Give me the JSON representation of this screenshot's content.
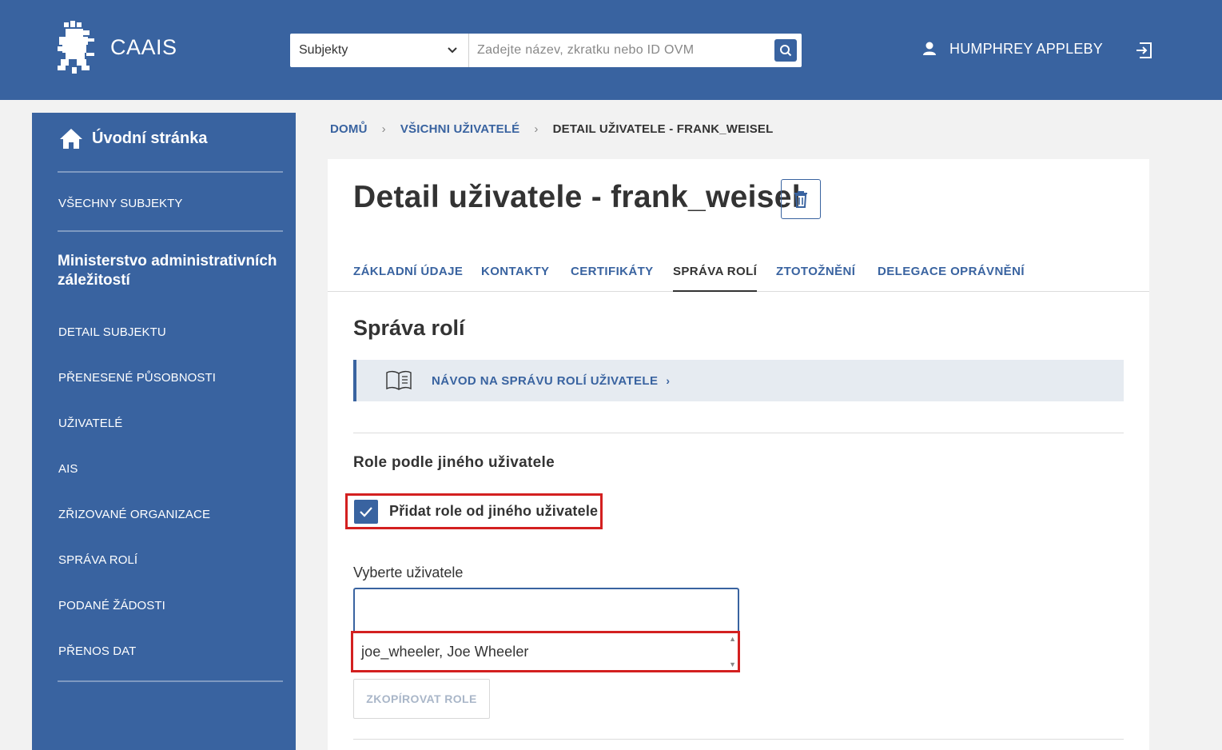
{
  "header": {
    "app_name": "CAAIS",
    "search_category": "Subjekty",
    "search_placeholder": "Zadejte název, zkratku nebo ID OVM",
    "user_name": "HUMPHREY APPLEBY",
    "colors": {
      "primary": "#3963a0",
      "highlight": "#d32020"
    }
  },
  "sidebar": {
    "home_label": "Úvodní stránka",
    "all_subjects": "VŠECHNY SUBJEKTY",
    "organization": "Ministerstvo administrativních záležitostí",
    "items": [
      {
        "label": "DETAIL SUBJEKTU"
      },
      {
        "label": "PŘENESENÉ PŮSOBNOSTI"
      },
      {
        "label": "UŽIVATELÉ"
      },
      {
        "label": "AIS"
      },
      {
        "label": "ZŘIZOVANÉ ORGANIZACE"
      },
      {
        "label": "SPRÁVA ROLÍ"
      },
      {
        "label": "PODANÉ ŽÁDOSTI"
      },
      {
        "label": "PŘENOS DAT"
      }
    ]
  },
  "breadcrumb": {
    "home": "DOMŮ",
    "users": "VŠICHNI UŽIVATELÉ",
    "current": "DETAIL UŽIVATELE - FRANK_WEISEL"
  },
  "main": {
    "title": "Detail uživatele - frank_weisel",
    "tabs": [
      {
        "label": "ZÁKLADNÍ ÚDAJE"
      },
      {
        "label": "KONTAKTY"
      },
      {
        "label": "CERTIFIKÁTY"
      },
      {
        "label": "SPRÁVA ROLÍ"
      },
      {
        "label": "ZTOTOŽNĚNÍ"
      },
      {
        "label": "DELEGACE OPRÁVNĚNÍ"
      }
    ],
    "active_tab": "SPRÁVA ROLÍ",
    "section_title": "Správa rolí",
    "guide_link": "NÁVOD NA SPRÁVU ROLÍ UŽIVATELE",
    "subsection_title": "Role podle jiného uživatele",
    "checkbox_label": "Přidat role od jiného uživatele",
    "checkbox_checked": true,
    "select_label": "Vyberte uživatele",
    "select_value": "",
    "options": [
      "joe_wheeler, Joe Wheeler"
    ],
    "copy_button": "ZKOPÍROVAT ROLE"
  }
}
